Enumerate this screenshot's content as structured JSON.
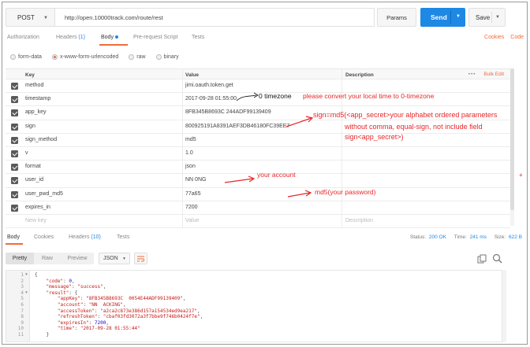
{
  "request": {
    "method": "POST",
    "url": "http://open.10000track.com/route/rest",
    "params_label": "Params",
    "send_label": "Send",
    "save_label": "Save"
  },
  "tabs": [
    {
      "label": "Authorization",
      "count": ""
    },
    {
      "label": "Headers",
      "count": "(1)"
    },
    {
      "label": "Body",
      "count": ""
    },
    {
      "label": "Pre-request Script",
      "count": ""
    },
    {
      "label": "Tests",
      "count": ""
    }
  ],
  "active_tab": "Body",
  "links": {
    "cookies": "Cookies",
    "code": "Code"
  },
  "body_types": [
    {
      "label": "form-data",
      "selected": false
    },
    {
      "label": "x-www-form-urlencoded",
      "selected": true
    },
    {
      "label": "raw",
      "selected": false
    },
    {
      "label": "binary",
      "selected": false
    }
  ],
  "table": {
    "headers": {
      "key": "Key",
      "value": "Value",
      "description": "Description"
    },
    "bulk_edit": "Bulk Edit",
    "rows": [
      {
        "key": "method",
        "value": "jimi.oauth.token.get",
        "checked": true
      },
      {
        "key": "timestamp",
        "value": "2017-09-28 01:55:00",
        "checked": true
      },
      {
        "key": "app_key",
        "value": "8FB345B8693C       244ADF99139409",
        "checked": true
      },
      {
        "key": "sign",
        "value": "800925191A8391AEF3DB46180FC39EE7",
        "checked": true
      },
      {
        "key": "sign_method",
        "value": "md5",
        "checked": true
      },
      {
        "key": "v",
        "value": "1.0",
        "checked": true
      },
      {
        "key": "format",
        "value": "json",
        "checked": true
      },
      {
        "key": "user_id",
        "value": "NN        0NG",
        "checked": true
      },
      {
        "key": "user_pwd_md5",
        "value": "                                    77a65",
        "checked": true
      },
      {
        "key": "expires_in",
        "value": "7200",
        "checked": true
      }
    ],
    "placeholder": {
      "key": "New key",
      "value": "Value",
      "description": "Description"
    }
  },
  "annotations": {
    "timezone": "0 timezone",
    "convert": "please convert your local time to 0-timezone",
    "sign_1": "sign=md5(<app_secret>your alphabet ordered parameters",
    "sign_2": "without comma, equal-sign, not include field",
    "sign_3": "sign<app_secret>)",
    "account": "your account",
    "password": "md5(your password)",
    "guide_mark": "+"
  },
  "response": {
    "tabs": [
      {
        "label": "Body",
        "count": ""
      },
      {
        "label": "Cookies",
        "count": ""
      },
      {
        "label": "Headers",
        "count": "(10)"
      },
      {
        "label": "Tests",
        "count": ""
      }
    ],
    "status_label": "Status:",
    "status_value": "200 OK",
    "time_label": "Time:",
    "time_value": "241 ms",
    "size_label": "Size:",
    "size_value": "622 B",
    "formats": [
      "Pretty",
      "Raw",
      "Preview"
    ],
    "format_type": "JSON",
    "code_lines": [
      {
        "n": "1",
        "fold": true,
        "html": "{"
      },
      {
        "n": "2",
        "fold": false,
        "key": "code",
        "val": "0",
        "kind": "n",
        "indent": 1
      },
      {
        "n": "3",
        "fold": false,
        "key": "message",
        "val": "\"success\"",
        "kind": "s",
        "indent": 1
      },
      {
        "n": "4",
        "fold": true,
        "key": "result",
        "val": "{",
        "kind": "p",
        "indent": 1
      },
      {
        "n": "5",
        "fold": false,
        "key": "appKey",
        "val": "\"8FB345B8693C  0054E44ADF99139409\"",
        "kind": "s",
        "indent": 2
      },
      {
        "n": "6",
        "fold": false,
        "key": "account",
        "val": "\"NN  ACKING\"",
        "kind": "s",
        "indent": 2
      },
      {
        "n": "7",
        "fold": false,
        "key": "accessToken",
        "val": "\"a2ca2c873e386d157a154534ed9ea217\"",
        "kind": "s",
        "indent": 2
      },
      {
        "n": "8",
        "fold": false,
        "key": "refreshToken",
        "val": "\"cbaf03fd3072a3f7bbe9f746b0424f7e\"",
        "kind": "s",
        "indent": 2
      },
      {
        "n": "9",
        "fold": false,
        "key": "expiresIn",
        "val": "7200",
        "kind": "n",
        "indent": 2
      },
      {
        "n": "10",
        "fold": false,
        "key": "time",
        "val": "\"2017-09-28 01:55:44\"",
        "kind": "s",
        "indent": 2
      },
      {
        "n": "11",
        "fold": false,
        "html": "    }"
      }
    ]
  },
  "colors": {
    "accent": "#f26b3a",
    "send": "#1e88e5",
    "annotation": "#e8262a"
  }
}
